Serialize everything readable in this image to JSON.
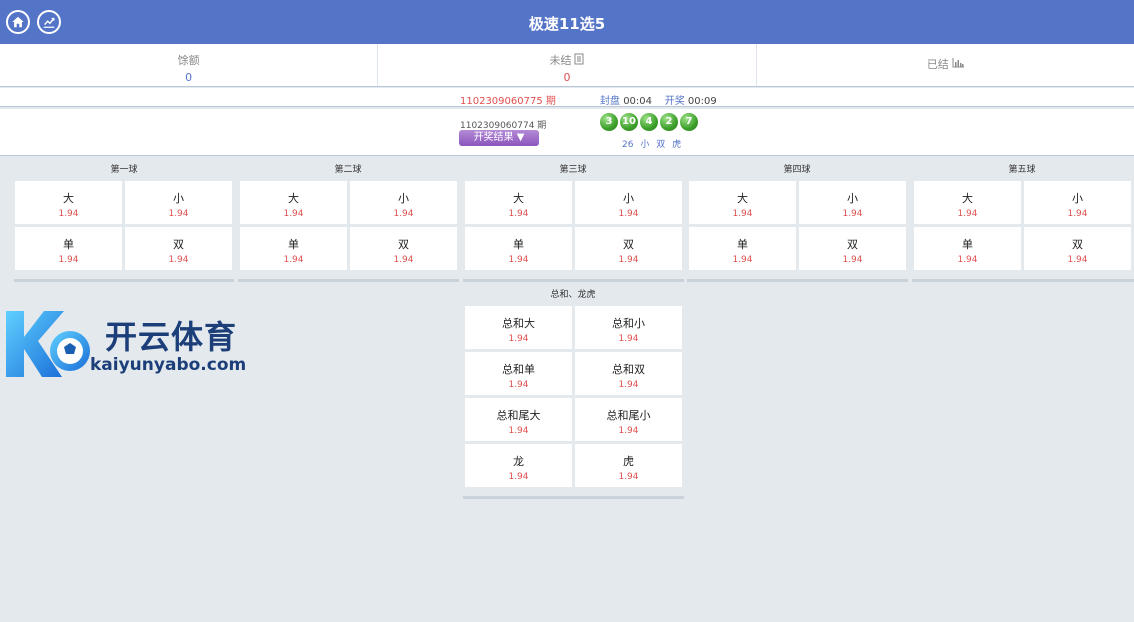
{
  "header": {
    "title": "极速11选5",
    "home_icon": "home-icon",
    "trend_icon": "trend-chart-icon"
  },
  "stats": {
    "balance_label": "馀额",
    "balance_value": "0",
    "unsettled_label": "未结",
    "unsettled_value": "0",
    "settled_label": "已结"
  },
  "current_issue": {
    "number": "1102309060775 期",
    "seal_label": "封盘",
    "seal_time": "00:04",
    "draw_label": "开奖",
    "draw_time": "00:09"
  },
  "last_draw": {
    "number": "1102309060774 期",
    "results_button": "开奖结果 ▼",
    "balls": [
      "3",
      "10",
      "4",
      "2",
      "7"
    ],
    "sum": "26",
    "size": "小",
    "parity": "双",
    "dragon_tiger": "虎"
  },
  "groups": [
    {
      "title": "第一球",
      "bets": [
        {
          "name": "大",
          "odds": "1.94"
        },
        {
          "name": "小",
          "odds": "1.94"
        },
        {
          "name": "单",
          "odds": "1.94"
        },
        {
          "name": "双",
          "odds": "1.94"
        }
      ]
    },
    {
      "title": "第二球",
      "bets": [
        {
          "name": "大",
          "odds": "1.94"
        },
        {
          "name": "小",
          "odds": "1.94"
        },
        {
          "name": "单",
          "odds": "1.94"
        },
        {
          "name": "双",
          "odds": "1.94"
        }
      ]
    },
    {
      "title": "第三球",
      "bets": [
        {
          "name": "大",
          "odds": "1.94"
        },
        {
          "name": "小",
          "odds": "1.94"
        },
        {
          "name": "单",
          "odds": "1.94"
        },
        {
          "name": "双",
          "odds": "1.94"
        }
      ]
    },
    {
      "title": "第四球",
      "bets": [
        {
          "name": "大",
          "odds": "1.94"
        },
        {
          "name": "小",
          "odds": "1.94"
        },
        {
          "name": "单",
          "odds": "1.94"
        },
        {
          "name": "双",
          "odds": "1.94"
        }
      ]
    },
    {
      "title": "第五球",
      "bets": [
        {
          "name": "大",
          "odds": "1.94"
        },
        {
          "name": "小",
          "odds": "1.94"
        },
        {
          "name": "单",
          "odds": "1.94"
        },
        {
          "name": "双",
          "odds": "1.94"
        }
      ]
    }
  ],
  "total_group": {
    "title": "总和、龙虎",
    "bets": [
      {
        "name": "总和大",
        "odds": "1.94"
      },
      {
        "name": "总和小",
        "odds": "1.94"
      },
      {
        "name": "总和单",
        "odds": "1.94"
      },
      {
        "name": "总和双",
        "odds": "1.94"
      },
      {
        "name": "总和尾大",
        "odds": "1.94"
      },
      {
        "name": "总和尾小",
        "odds": "1.94"
      },
      {
        "name": "龙",
        "odds": "1.94"
      },
      {
        "name": "虎",
        "odds": "1.94"
      }
    ]
  },
  "watermark": {
    "cn": "开云体育",
    "en": "kaiyunyabo.com"
  },
  "colors": {
    "header": "#5474c8",
    "odds": "#e0504f",
    "link": "#5474c8",
    "ball": "#3c9f2a"
  }
}
